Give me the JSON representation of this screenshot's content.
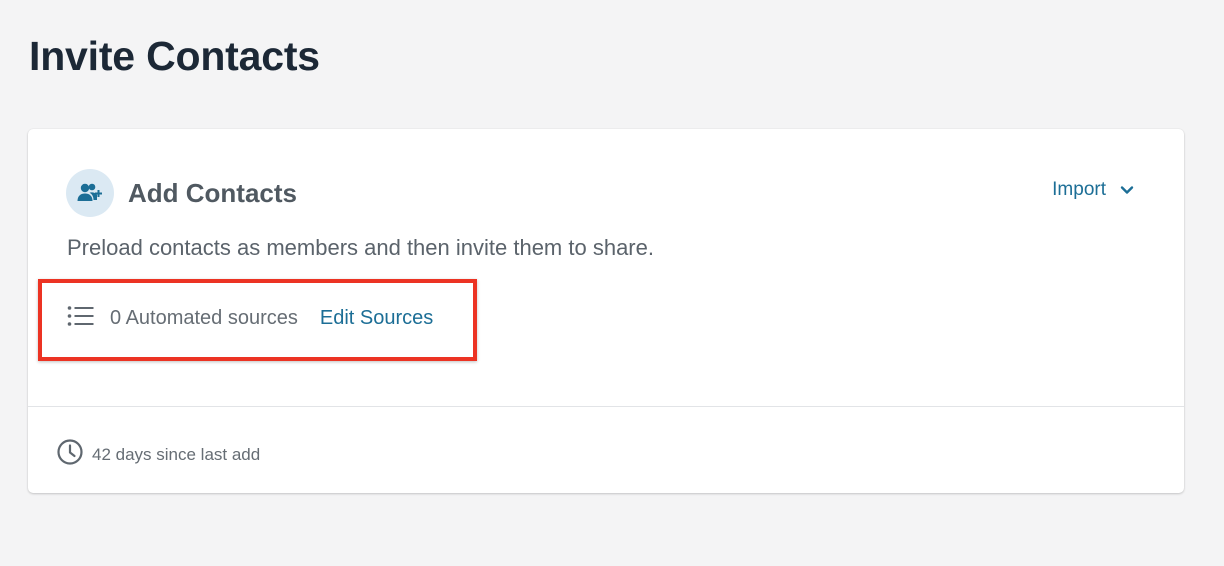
{
  "page": {
    "title": "Invite Contacts"
  },
  "card": {
    "icon": "add-user-icon",
    "title": "Add Contacts",
    "import_label": "Import",
    "import_icon": "chevron-down-icon",
    "description": "Preload contacts as members and then invite them to share.",
    "sources": {
      "icon": "list-icon",
      "count_label": "0 Automated sources",
      "edit_label": "Edit Sources"
    },
    "footer": {
      "icon": "clock-icon",
      "text": "42 days since last add"
    }
  },
  "colors": {
    "accent": "#1c6e96",
    "highlight": "#ec3323",
    "background": "#f4f4f5"
  }
}
